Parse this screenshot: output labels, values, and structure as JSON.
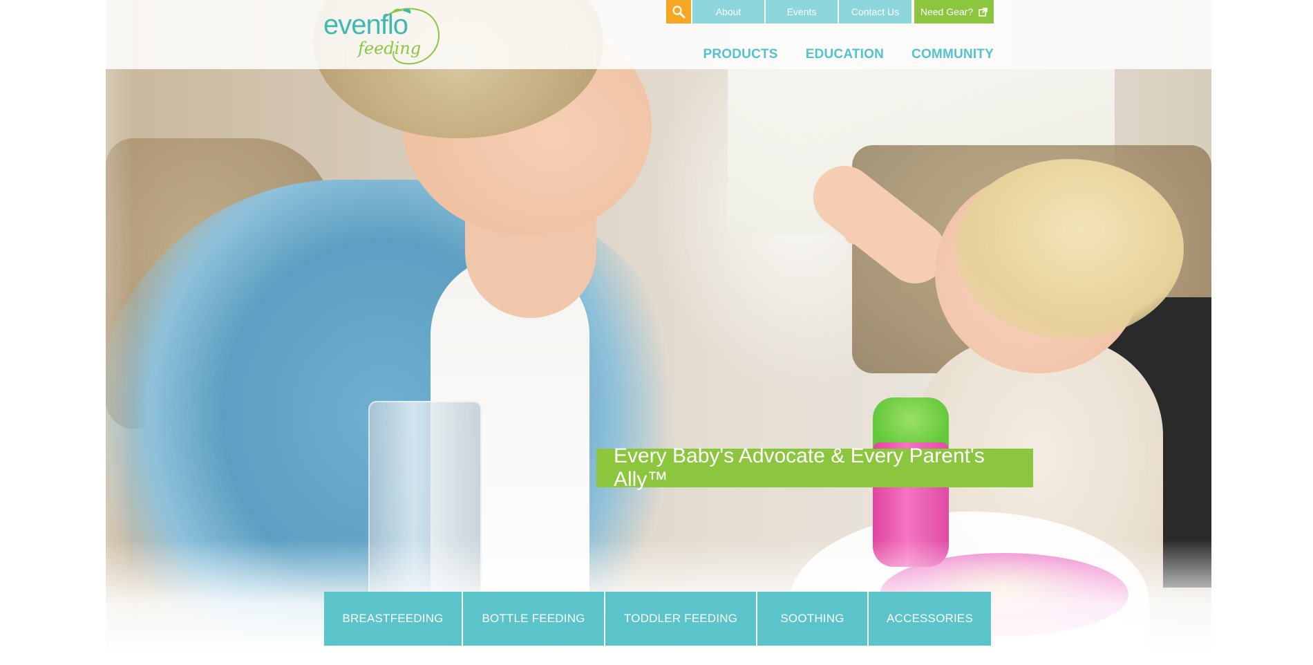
{
  "header": {
    "logo": {
      "brand": "evenflo",
      "sub": "feeding"
    },
    "search": {
      "icon": "search-icon"
    },
    "utility_nav": [
      {
        "label": "About"
      },
      {
        "label": "Events"
      },
      {
        "label": "Contact Us"
      }
    ],
    "need_gear": {
      "label": "Need Gear?",
      "icon": "external-link-icon"
    },
    "main_nav": [
      {
        "label": "PRODUCTS"
      },
      {
        "label": "EDUCATION"
      },
      {
        "label": "COMMUNITY"
      }
    ]
  },
  "hero": {
    "tagline": "Every Baby's Advocate & Every Parent's Ally™"
  },
  "category_nav": [
    {
      "label": "BREASTFEEDING"
    },
    {
      "label": "BOTTLE FEEDING"
    },
    {
      "label": "TODDLER FEEDING"
    },
    {
      "label": "SOOTHING"
    },
    {
      "label": "ACCESSORIES"
    }
  ],
  "colors": {
    "teal": "#5bc4cb",
    "light_teal": "#8dd6dc",
    "green": "#8cc63f",
    "orange": "#f5a623",
    "nav_text": "#52c3cc"
  }
}
